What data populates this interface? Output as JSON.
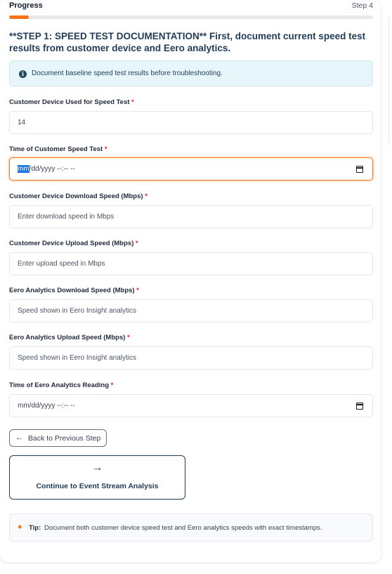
{
  "progress": {
    "label": "Progress",
    "step": "Step 4",
    "fraction": 0.055,
    "accent": "#f97316"
  },
  "step_title": "**STEP 1: SPEED TEST DOCUMENTATION** First, document current speed test results from customer device and Eero analytics.",
  "info": {
    "icon": "info-circle-icon",
    "text": "Document baseline speed test results before troubleshooting."
  },
  "fields": {
    "device": {
      "label": "Customer Device Used for Speed Test",
      "required": "*",
      "value": "14"
    },
    "time": {
      "label": "Time of Customer Speed Test",
      "required": "*",
      "value_selected": "mm",
      "value_rest": "/dd/yyyy --:-- --"
    },
    "download": {
      "label": "Customer Device Download Speed (Mbps)",
      "required": "*",
      "placeholder": "Enter download speed in Mbps"
    },
    "upload": {
      "label": "Customer Device Upload Speed (Mbps)",
      "required": "*",
      "placeholder": "Enter upload speed in Mbps"
    },
    "eero_download": {
      "label": "Eero Analytics Download Speed (Mbps)",
      "required": "*",
      "placeholder": "Speed shown in Eero Insight analytics"
    },
    "eero_upload": {
      "label": "Eero Analytics Upload Speed (Mbps)",
      "required": "*",
      "placeholder": "Speed shown in Eero Insight analytics"
    },
    "eero_time": {
      "label": "Time of Eero Analytics Reading",
      "required": "*",
      "value": "mm/dd/yyyy --:-- --"
    }
  },
  "buttons": {
    "back": "Back to Previous Step",
    "back_icon": "arrow-left-icon",
    "continue": "Continue to Event Stream Analysis",
    "continue_icon": "arrow-right-icon"
  },
  "tip": {
    "icon": "lightbulb-icon",
    "label": "Tip:",
    "text": "Document both customer device speed test and Eero analytics speeds with exact timestamps."
  }
}
